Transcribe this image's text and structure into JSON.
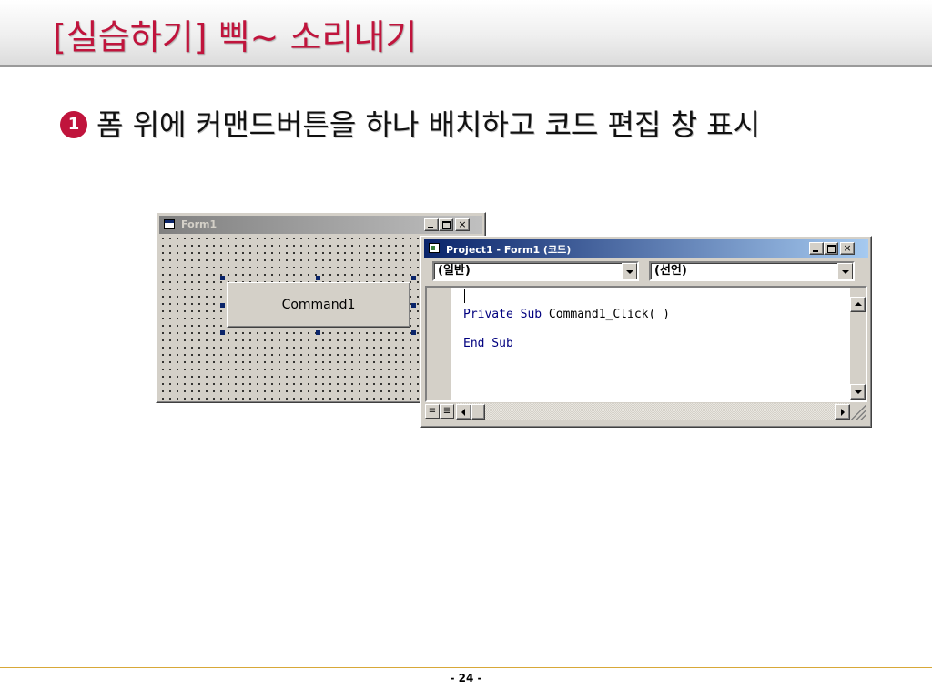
{
  "slide": {
    "title": "[실습하기] 삑~ 소리내기",
    "bullet_mark": "1",
    "bullet_text": "폼 위에 커맨드버튼을 하나 배치하고 코드 편집 창 표시",
    "page_number": "- 24 -"
  },
  "form_window": {
    "title": "Form1",
    "icon": "form-icon",
    "title_buttons": [
      "_",
      "□",
      "×"
    ],
    "command_button_caption": "Command1"
  },
  "code_window": {
    "title": "Project1 - Form1 (코드)",
    "icon": "code-window-icon",
    "title_buttons": [
      "_",
      "□",
      "×"
    ],
    "object_combo": "(일반)",
    "procedure_combo": "(선언)",
    "code_lines": [
      {
        "keyword": "Private Sub",
        "rest": " Command1_Click( )"
      },
      {
        "keyword": "End Sub",
        "rest": ""
      }
    ]
  },
  "colors": {
    "title_red": "#c0143c",
    "active_title": "#0a246a",
    "inactive_title": "#808080",
    "keyword_blue": "#00007f",
    "footer_line": "#d8a838"
  }
}
